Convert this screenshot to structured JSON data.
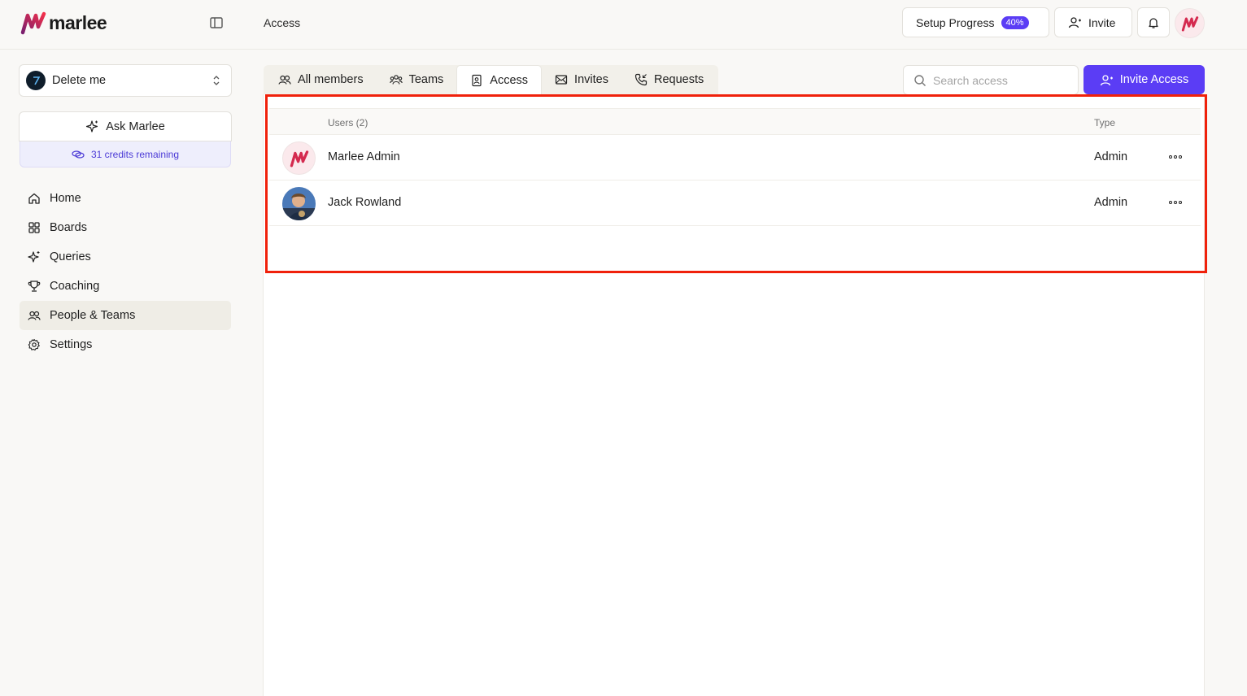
{
  "brand": {
    "name": "marlee"
  },
  "header": {
    "breadcrumb": "Access",
    "setup_label": "Setup Progress",
    "setup_percent": "40%",
    "invite_label": "Invite"
  },
  "sidebar": {
    "workspace": "Delete me",
    "ask_label": "Ask Marlee",
    "credits": "31 credits remaining",
    "items": [
      {
        "label": "Home",
        "icon": "home-icon"
      },
      {
        "label": "Boards",
        "icon": "grid-icon"
      },
      {
        "label": "Queries",
        "icon": "sparkle-icon"
      },
      {
        "label": "Coaching",
        "icon": "trophy-icon"
      },
      {
        "label": "People & Teams",
        "icon": "people-icon",
        "active": true
      },
      {
        "label": "Settings",
        "icon": "gear-icon"
      }
    ]
  },
  "tabs": [
    {
      "label": "All members",
      "icon": "users-icon"
    },
    {
      "label": "Teams",
      "icon": "team-icon"
    },
    {
      "label": "Access",
      "icon": "badge-icon",
      "active": true
    },
    {
      "label": "Invites",
      "icon": "mail-icon"
    },
    {
      "label": "Requests",
      "icon": "phone-icon"
    }
  ],
  "search": {
    "placeholder": "Search access"
  },
  "invite_access_label": "Invite Access",
  "table": {
    "columns": {
      "users": "Users (2)",
      "type": "Type"
    },
    "rows": [
      {
        "name": "Marlee Admin",
        "type": "Admin"
      },
      {
        "name": "Jack Rowland",
        "type": "Admin"
      }
    ]
  },
  "colors": {
    "accent": "#5b3df5",
    "highlight": "#f0210b"
  }
}
